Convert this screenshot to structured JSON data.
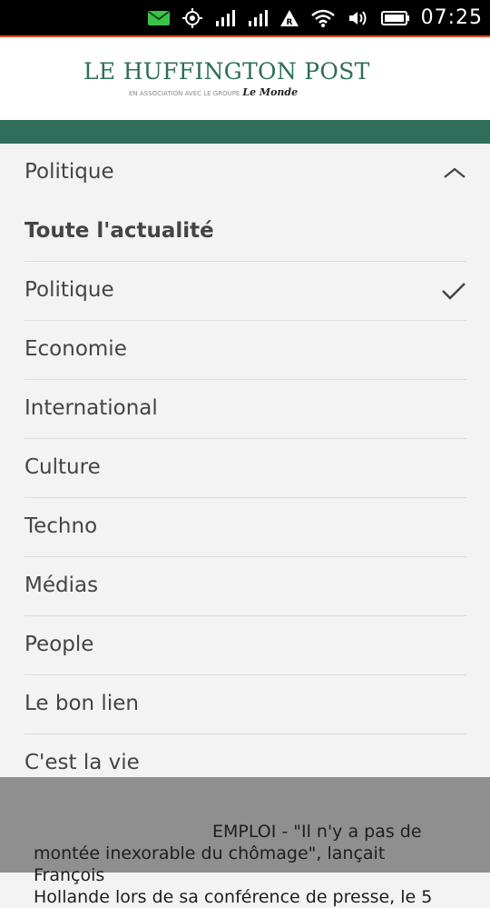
{
  "status_bar": {
    "time": "07:25",
    "icons": [
      "email-icon",
      "location-icon",
      "signal-1-icon",
      "signal-2-icon",
      "roaming-icon",
      "wifi-icon",
      "volume-icon",
      "battery-icon"
    ]
  },
  "header": {
    "logo_title": "LE HUFFINGTON POST",
    "logo_subtitle": "EN ASSOCIATION AVEC LE GROUPE",
    "logo_partner": "Le Monde",
    "brand_color": "#2e6e5a"
  },
  "menu": {
    "current_section": "Politique",
    "items": [
      {
        "label": "Toute l'actualité",
        "selected": false
      },
      {
        "label": "Politique",
        "selected": true
      },
      {
        "label": "Economie",
        "selected": false
      },
      {
        "label": "International",
        "selected": false
      },
      {
        "label": "Culture",
        "selected": false
      },
      {
        "label": "Techno",
        "selected": false
      },
      {
        "label": "Médias",
        "selected": false
      },
      {
        "label": "People",
        "selected": false
      },
      {
        "label": "Le bon lien",
        "selected": false
      },
      {
        "label": "C'est la vie",
        "selected": false
      }
    ]
  },
  "article_preview": {
    "line1": "EMPLOI - \"Il n'y a pas de",
    "line2": "montée inexorable du chômage\", lançait François",
    "line3": "Hollande lors de sa conférence de presse, le 5"
  }
}
